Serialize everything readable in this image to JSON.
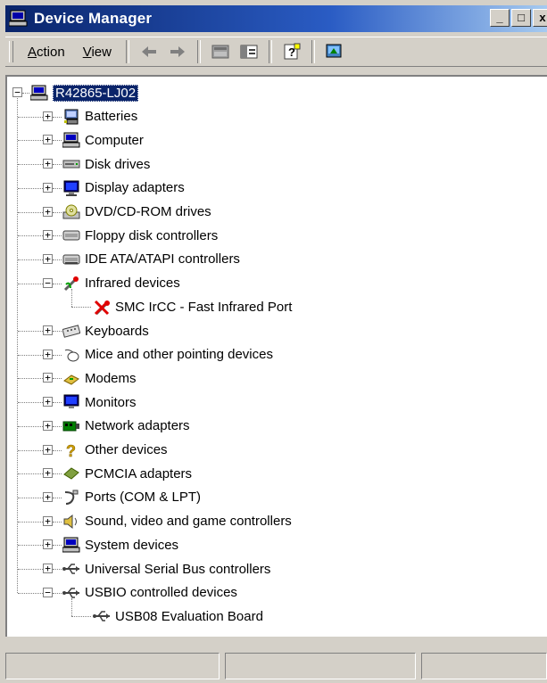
{
  "window": {
    "title": "Device Manager",
    "controls": {
      "minimize": "_",
      "maximize": "□",
      "close": "x"
    }
  },
  "toolbar": {
    "menus": [
      {
        "prefix": "",
        "hotkey": "A",
        "rest": "ction"
      },
      {
        "prefix": "",
        "hotkey": "V",
        "rest": "iew"
      }
    ],
    "buttons": [
      "back-arrow-icon",
      "forward-arrow-icon",
      "properties-icon",
      "split-view-icon",
      "help-icon",
      "scan-hardware-icon"
    ]
  },
  "tree": {
    "root": {
      "label": "R42865-LJ02",
      "icon": "computer-icon",
      "expander": "−"
    },
    "nodes": [
      {
        "label": "Batteries",
        "icon": "battery-icon",
        "expander": "+"
      },
      {
        "label": "Computer",
        "icon": "computer-icon",
        "expander": "+"
      },
      {
        "label": "Disk drives",
        "icon": "disk-drive-icon",
        "expander": "+"
      },
      {
        "label": "Display adapters",
        "icon": "display-adapter-icon",
        "expander": "+"
      },
      {
        "label": "DVD/CD-ROM drives",
        "icon": "cdrom-icon",
        "expander": "+"
      },
      {
        "label": "Floppy disk controllers",
        "icon": "floppy-controller-icon",
        "expander": "+"
      },
      {
        "label": "IDE ATA/ATAPI controllers",
        "icon": "ide-controller-icon",
        "expander": "+"
      },
      {
        "label": "Infrared devices",
        "icon": "infrared-icon",
        "expander": "−",
        "children": [
          {
            "label": "SMC IrCC - Fast Infrared Port",
            "icon": "infrared-disabled-icon"
          }
        ]
      },
      {
        "label": "Keyboards",
        "icon": "keyboard-icon",
        "expander": "+"
      },
      {
        "label": "Mice and other pointing devices",
        "icon": "mouse-icon",
        "expander": "+"
      },
      {
        "label": "Modems",
        "icon": "modem-icon",
        "expander": "+"
      },
      {
        "label": "Monitors",
        "icon": "monitor-icon",
        "expander": "+"
      },
      {
        "label": "Network adapters",
        "icon": "network-adapter-icon",
        "expander": "+"
      },
      {
        "label": "Other devices",
        "icon": "question-mark-icon",
        "expander": "+"
      },
      {
        "label": "PCMCIA adapters",
        "icon": "pcmcia-icon",
        "expander": "+"
      },
      {
        "label": "Ports (COM & LPT)",
        "icon": "port-icon",
        "expander": "+"
      },
      {
        "label": "Sound, video and game controllers",
        "icon": "speaker-icon",
        "expander": "+"
      },
      {
        "label": "System devices",
        "icon": "computer-icon",
        "expander": "+"
      },
      {
        "label": "Universal Serial Bus controllers",
        "icon": "usb-icon",
        "expander": "+"
      },
      {
        "label": "USBIO controlled devices",
        "icon": "usb-icon",
        "expander": "−",
        "children": [
          {
            "label": "USB08 Evaluation Board",
            "icon": "usb-icon"
          }
        ]
      }
    ]
  },
  "statusbar": {
    "panels": [
      "",
      "",
      ""
    ]
  },
  "colors": {
    "titlebar_start": "#0a246a",
    "titlebar_end": "#a6caf0",
    "face": "#d4d0c8",
    "selection": "#0a246a"
  }
}
